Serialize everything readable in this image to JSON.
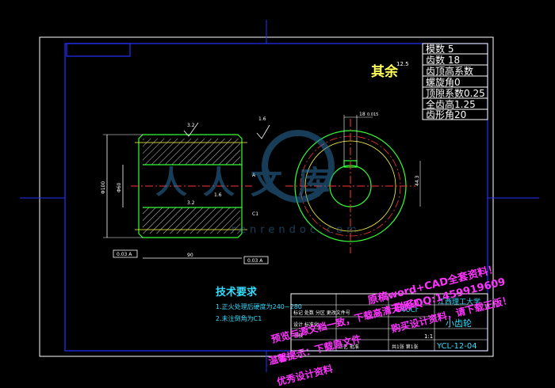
{
  "drawing": {
    "roughness_note": "其余",
    "roughness_value": "12.5",
    "param_table": [
      "模数 5",
      "齿数 18",
      "齿顶高系数",
      "螺旋角0",
      "顶隙系数0.25",
      "全齿高1.25",
      "齿形角20"
    ],
    "tech_req_title": "技术要求",
    "tech_req_items": [
      "1.正火处理后硬度为240~280",
      "2.未注倒角为C1"
    ],
    "section_dims": {
      "outer_dia": "Φ100",
      "bore_dia": "Φ60",
      "length": "90",
      "chamfer": "C1",
      "left_tol": "0.03 A",
      "right_tol": "0.03 A",
      "surface_r1": "3.2",
      "surface_r2": "3.2",
      "surface_r3": "1.6",
      "surface_r4": "1.6",
      "datum": "A"
    },
    "end_view_dims": {
      "keyway_width": "18",
      "keyway_tol": "0.015",
      "keyway_depth": "44.3"
    },
    "title_block": {
      "school": "江西理工大学",
      "material": "40Cr",
      "part_name": "小齿轮",
      "drawing_no": "YCL-12-04",
      "scale": "1:1",
      "row1": "标记 处数 分区 更改文件号",
      "row2": "设计 标准化",
      "row3": "审核",
      "row4": "工艺 批准",
      "sheet": "共1张 第1张"
    }
  },
  "watermark": {
    "site_logo": "人人文库",
    "site_url": "renrendoc.com",
    "line1": "预览与源文档一致，下载高清无水印",
    "line2": "原稿word+CAD全套资料！",
    "line3": "联系QQ:1459919609",
    "line4": "温馨提示：下载原文件",
    "line5": "购买设计资料，请下载正版！",
    "line6": "优秀设计资料"
  }
}
